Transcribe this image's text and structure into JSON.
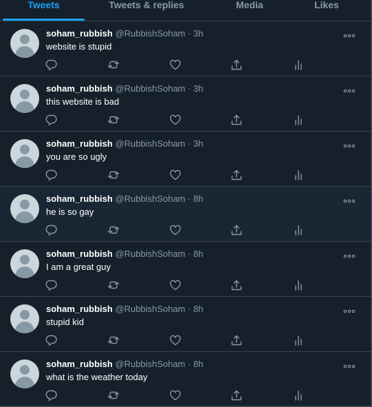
{
  "tabs": [
    {
      "label": "Tweets",
      "active": true
    },
    {
      "label": "Tweets & replies",
      "active": false
    },
    {
      "label": "Media",
      "active": false
    },
    {
      "label": "Likes",
      "active": false
    }
  ],
  "tweets": [
    {
      "name": "soham_rubbish",
      "handle": "@RubbishSoham",
      "separator": "·",
      "time": "3h",
      "text": "website is stupid"
    },
    {
      "name": "soham_rubbish",
      "handle": "@RubbishSoham",
      "separator": "·",
      "time": "3h",
      "text": "this website is bad"
    },
    {
      "name": "soham_rubbish",
      "handle": "@RubbishSoham",
      "separator": "·",
      "time": "3h",
      "text": "you are so ugly"
    },
    {
      "name": "soham_rubbish",
      "handle": "@RubbishSoham",
      "separator": "·",
      "time": "8h",
      "text": "he is so gay"
    },
    {
      "name": "soham_rubbish",
      "handle": "@RubbishSoham",
      "separator": "·",
      "time": "8h",
      "text": "I am a great guy"
    },
    {
      "name": "soham_rubbish",
      "handle": "@RubbishSoham",
      "separator": "·",
      "time": "8h",
      "text": "stupid kid"
    },
    {
      "name": "soham_rubbish",
      "handle": "@RubbishSoham",
      "separator": "·",
      "time": "8h",
      "text": "what is the weather today"
    }
  ],
  "icons": {
    "reply": "reply-icon",
    "retweet": "retweet-icon",
    "like": "heart-icon",
    "share": "share-icon",
    "analytics": "analytics-icon",
    "more": "more-icon"
  },
  "colors": {
    "background": "#15202b",
    "hover_background": "#192734",
    "accent": "#1da1f2",
    "secondary_text": "#8899a6",
    "border": "#38444d"
  }
}
